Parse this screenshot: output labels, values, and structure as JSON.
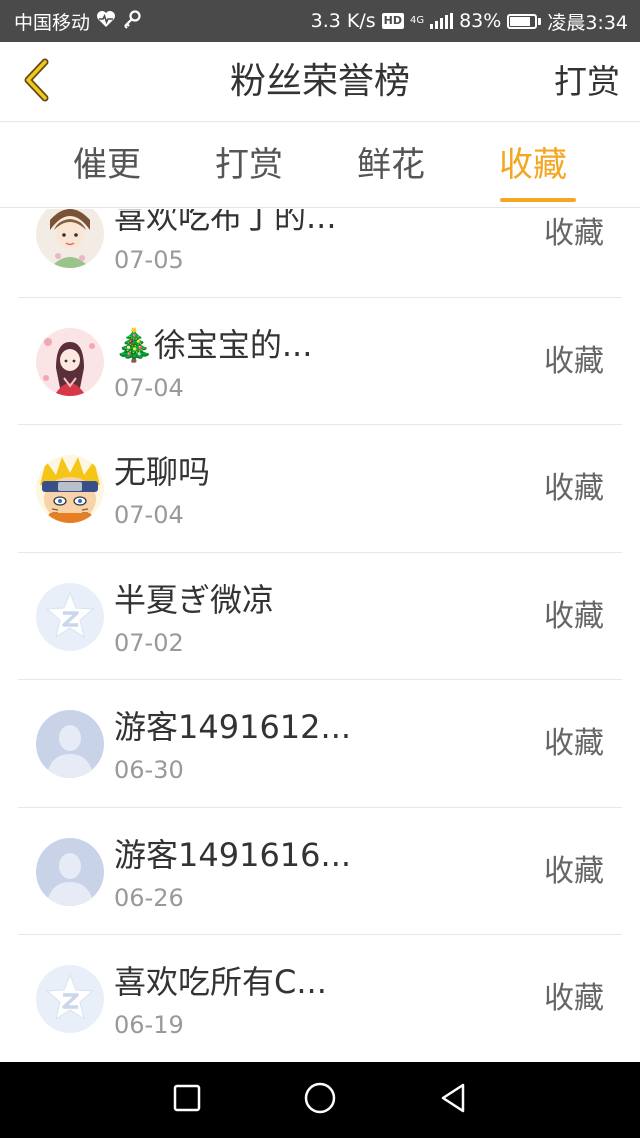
{
  "status_bar": {
    "carrier": "中国移动",
    "net_speed": "3.3 K/s",
    "hd": "HD",
    "net_type": "4G",
    "battery": "83%",
    "battery_level": 0.83,
    "time": "凌晨3:34",
    "icons": [
      "heart-pulse-icon",
      "key-icon",
      "signal-icon",
      "battery-icon"
    ]
  },
  "header": {
    "title": "粉丝荣誉榜",
    "right_button": "打赏",
    "back_icon": "chevron-left-icon",
    "accent": "#f5a623"
  },
  "tabs": [
    {
      "label": "催更",
      "active": false
    },
    {
      "label": "打赏",
      "active": false
    },
    {
      "label": "鲜花",
      "active": false
    },
    {
      "label": "收藏",
      "active": true
    }
  ],
  "list": {
    "items": [
      {
        "name": "喜欢吃布丁的...",
        "date": "07-05",
        "action": "收藏",
        "avatar": "girl-illustration-avatar"
      },
      {
        "name": "🎄徐宝宝的...",
        "date": "07-04",
        "action": "收藏",
        "avatar": "anime-girl-avatar"
      },
      {
        "name": "无聊吗",
        "date": "07-04",
        "action": "收藏",
        "avatar": "naruto-avatar"
      },
      {
        "name": "半夏ぎ微凉",
        "date": "07-02",
        "action": "收藏",
        "avatar": "default-z-avatar"
      },
      {
        "name": "游客1491612...",
        "date": "06-30",
        "action": "收藏",
        "avatar": "default-person-avatar"
      },
      {
        "name": "游客1491616...",
        "date": "06-26",
        "action": "收藏",
        "avatar": "default-person-avatar"
      },
      {
        "name": "喜欢吃所有C...",
        "date": "06-19",
        "action": "收藏",
        "avatar": "default-z-avatar"
      }
    ]
  },
  "nav_bar": {
    "buttons": [
      "recent-apps-icon",
      "home-icon",
      "back-icon"
    ]
  }
}
